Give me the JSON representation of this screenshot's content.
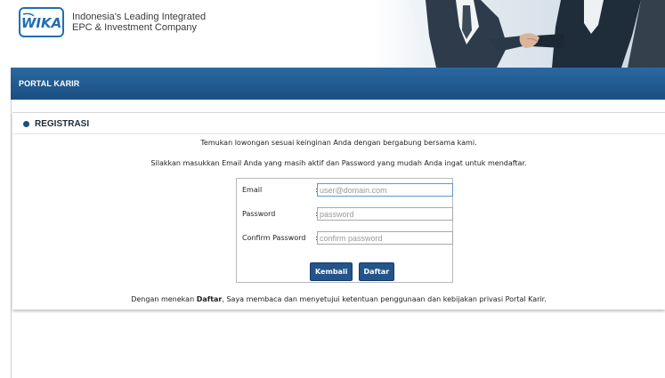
{
  "header": {
    "logo_text": "WIKA",
    "tagline_line1": "Indonesia's Leading Integrated",
    "tagline_line2": "EPC & Investment Company"
  },
  "nav": {
    "item": "PORTAL KARIR"
  },
  "panel": {
    "title": "REGISTRASI",
    "intro": "Temukan lowongan sesuai keinginan Anda dengan bergabung bersama kami.",
    "instruction": "Silakkan masukkan Email Anda yang masih aktif dan Password yang mudah Anda ingat untuk mendaftar.",
    "form": {
      "email_label": "Email",
      "email_placeholder": "user@domain.com",
      "password_label": "Password",
      "password_placeholder": "password",
      "confirm_label": "Confirm Password",
      "confirm_placeholder": "confirm password",
      "colon": ":"
    },
    "buttons": {
      "back": "Kembali",
      "register": "Daftar"
    },
    "footnote_pre": "Dengan menekan ",
    "footnote_bold": "Daftar",
    "footnote_post": ", Saya membaca dan menyetujui ketentuan penggunaan dan kebijakan privasi Portal Karir."
  },
  "colors": {
    "brand": "#1a4f82",
    "nav_top": "#2a68a0",
    "logo_blue": "#1f6fb2"
  }
}
